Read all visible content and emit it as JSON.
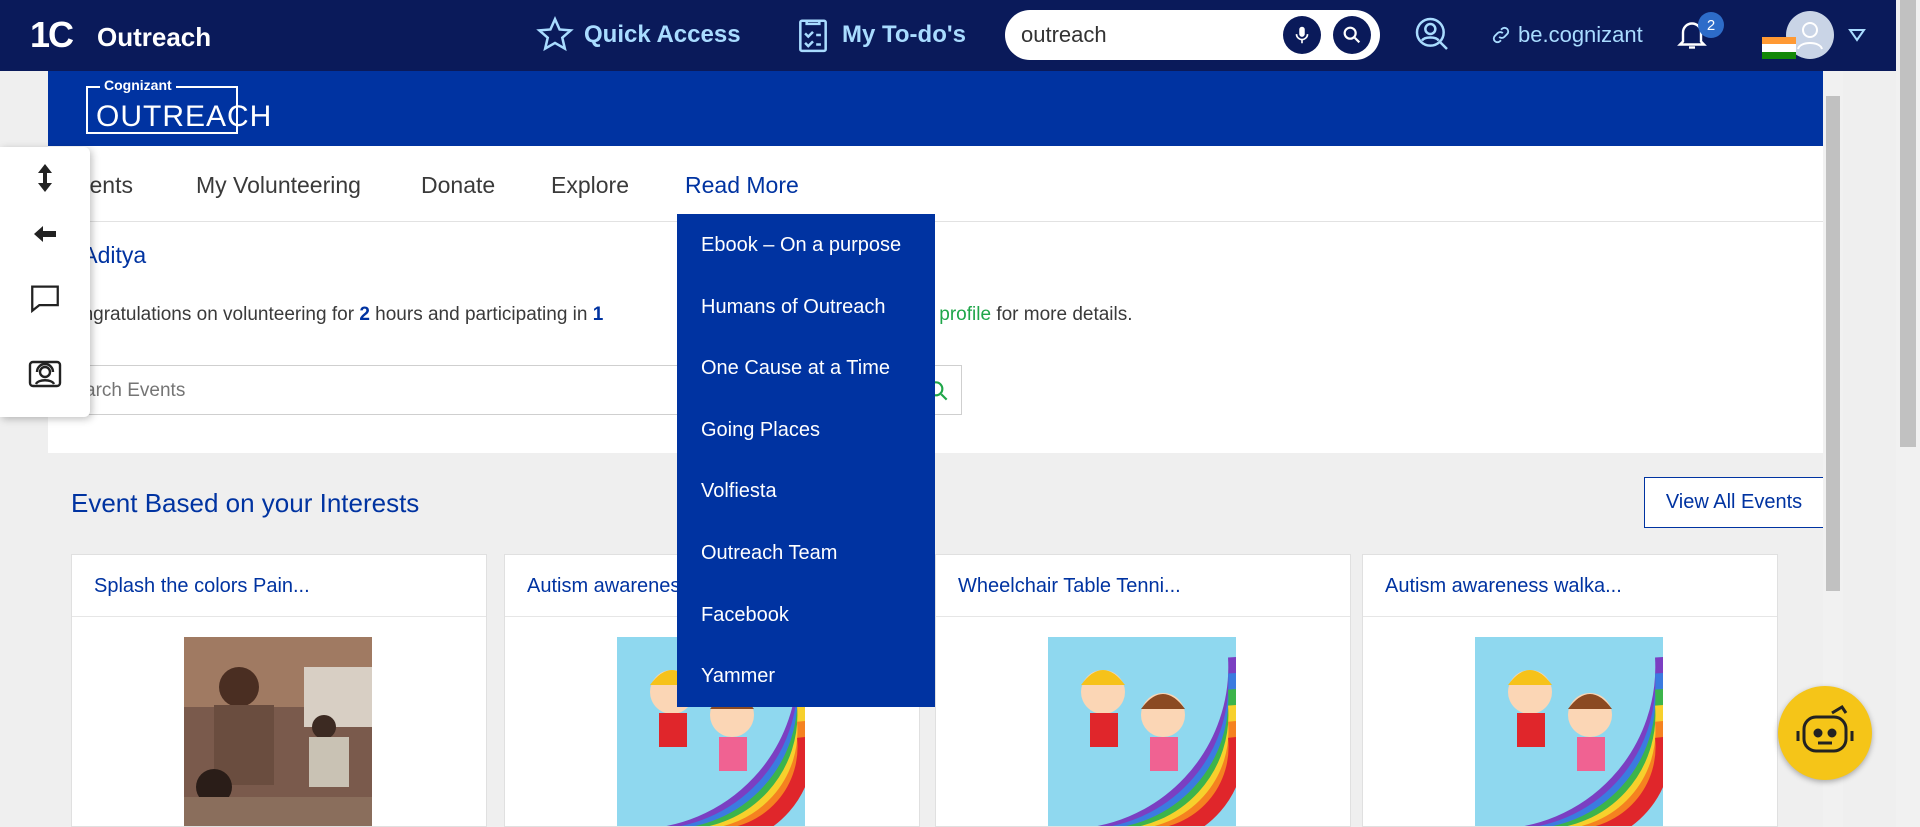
{
  "topbar": {
    "logo": "1C",
    "title": "Outreach",
    "quick_access": "Quick Access",
    "todos": "My To-do's",
    "search_value": "outreach",
    "be_link": "be.cognizant",
    "notification_count": "2"
  },
  "site": {
    "logo_small": "Cognizant",
    "logo_big": "OUTREACH"
  },
  "nav": {
    "events": "vents",
    "my_volunteering": "My Volunteering",
    "donate": "Donate",
    "explore": "Explore",
    "read_more": "Read More"
  },
  "greeting": "i Aditya",
  "congrats": {
    "p1": "ongratulations on volunteering for",
    "hours": "2",
    "p2": "hours and participating in",
    "events": "1",
    "link": "teering profile",
    "p3": "for more details."
  },
  "event_search_placeholder": "arch Events",
  "section_title": "Event Based on your Interests",
  "view_all": "View All Events",
  "cards": [
    {
      "title": "Splash the colors Pain..."
    },
    {
      "title": "Autism awarenes"
    },
    {
      "title": "Wheelchair Table Tenni..."
    },
    {
      "title": "Autism awareness walka..."
    }
  ],
  "dropdown": [
    "Ebook – On a purpose",
    "Humans of Outreach",
    "One Cause at a Time",
    "Going Places",
    "Volfiesta",
    "Outreach Team",
    "Facebook",
    "Yammer"
  ],
  "icons": {
    "quick_access": "star-icon",
    "todos": "checklist-icon",
    "mic": "mic-icon",
    "search": "search-icon",
    "profile_search": "user-search-icon",
    "link": "link-icon",
    "bell": "bell-icon",
    "caret": "caret-down-icon",
    "side_tools": [
      "expand-vertical-icon",
      "arrow-left-icon",
      "chat-icon",
      "support-icon"
    ]
  },
  "colors": {
    "topbar": "#0a1a5a",
    "brand": "#0033a1",
    "accent": "#a9dcff",
    "link_green": "#1fa649",
    "bot": "#f5c518"
  }
}
